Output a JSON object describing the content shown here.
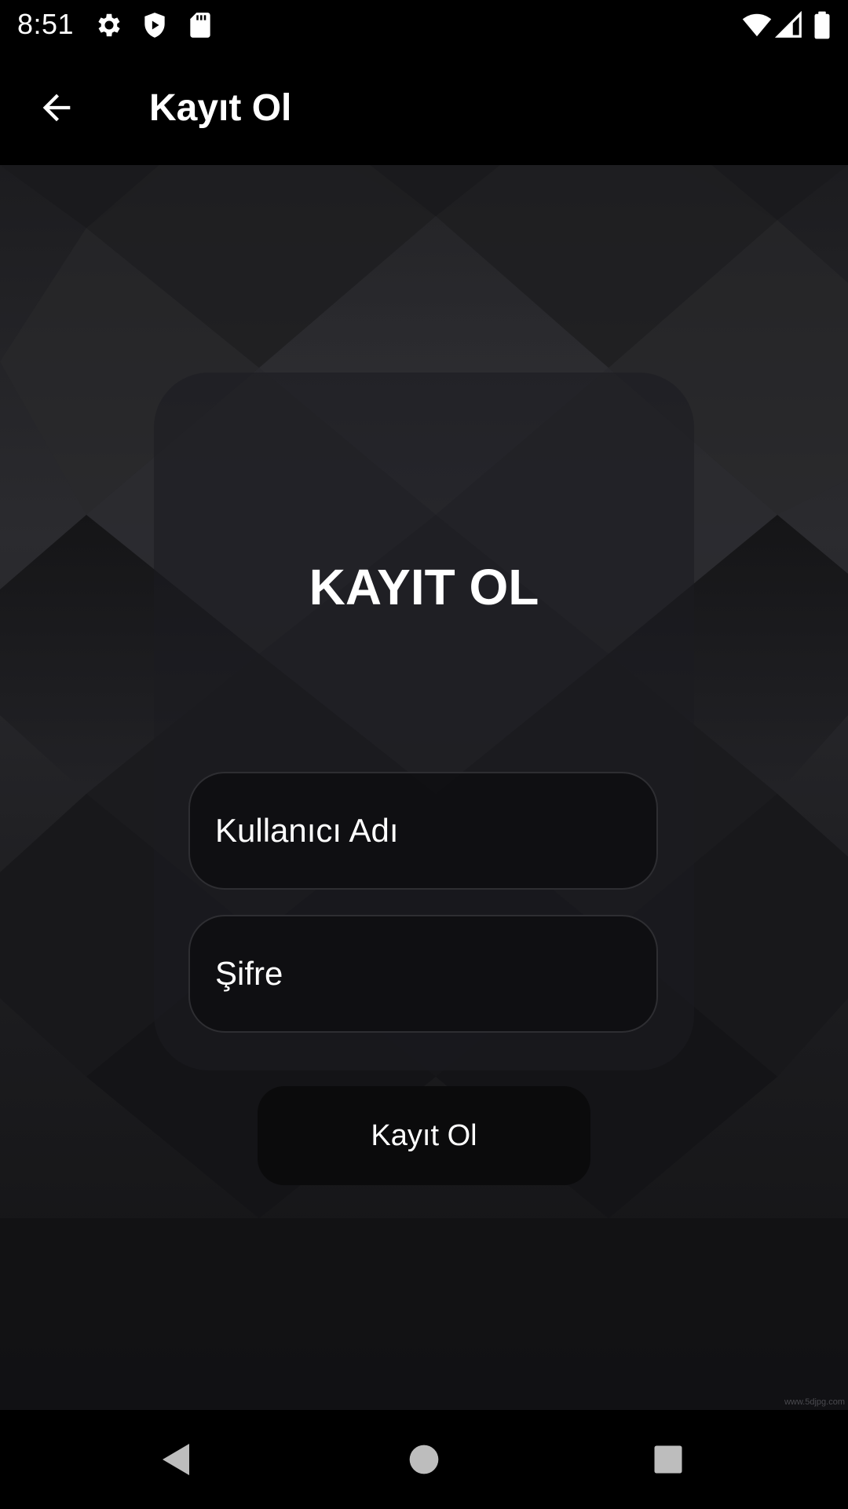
{
  "status_bar": {
    "time": "8:51",
    "icons_left": [
      "gear-icon",
      "shield-play-icon",
      "sd-card-icon"
    ],
    "icons_right": [
      "wifi-icon",
      "cellular-signal-icon",
      "battery-icon"
    ]
  },
  "app_bar": {
    "title": "Kayıt Ol",
    "back_icon": "arrow-back-icon"
  },
  "form": {
    "heading": "KAYIT OL",
    "username_placeholder": "Kullanıcı Adı",
    "password_placeholder": "Şifre",
    "submit_label": "Kayıt Ol"
  },
  "watermark": "www.5djpg.com",
  "nav_bar": {
    "icons": [
      "back-triangle-icon",
      "home-circle-icon",
      "recents-square-icon"
    ]
  },
  "colors": {
    "background": "#131316",
    "bars": "#000000",
    "text": "#ffffff",
    "field_border": "#2e2e32",
    "button": "#0b0b0c"
  }
}
